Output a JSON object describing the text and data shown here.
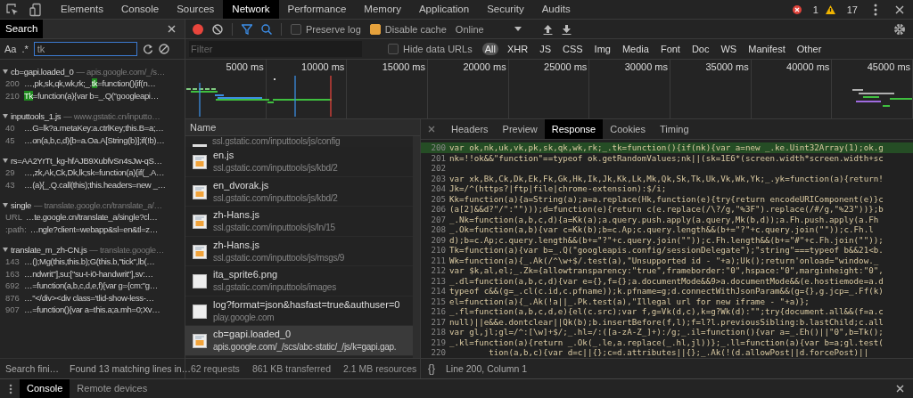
{
  "toolbar": {
    "tabs": [
      {
        "label": "Elements",
        "selected": false
      },
      {
        "label": "Console",
        "selected": false
      },
      {
        "label": "Sources",
        "selected": false
      },
      {
        "label": "Network",
        "selected": true
      },
      {
        "label": "Performance",
        "selected": false
      },
      {
        "label": "Memory",
        "selected": false
      },
      {
        "label": "Application",
        "selected": false
      },
      {
        "label": "Security",
        "selected": false
      },
      {
        "label": "Audits",
        "selected": false
      }
    ],
    "errors": "1",
    "warnings": "17"
  },
  "search_panel": {
    "tab": "Search",
    "match_case": "Aa",
    "regex": ".*",
    "query": "tk",
    "groups": [
      {
        "file": "cb=gapi.loaded_0",
        "source": "— apis.google.com/_/s…",
        "expanded": true,
        "matches": [
          {
            "line": "200",
            "before": "…,pk,sk,qk,wk,rk;_.",
            "match": "tk",
            "after": "=function(){if(n…"
          },
          {
            "line": "210",
            "match": "Tk",
            "after": "=function(a){var b=_.Q(\"googleapi…"
          }
        ]
      },
      {
        "file": "inputtools_1.js",
        "source": "— www.gstatic.cn/inputto…",
        "expanded": true,
        "matches": [
          {
            "line": "40",
            "before": "…G=lk?a.metaKey:a.ctrlKey;this.B=a;…"
          },
          {
            "line": "45",
            "before": "…on(a,b,c,d){b=a.Oa.A[String(b)];if(!b)…"
          }
        ]
      },
      {
        "file": "rs=AA2YrTt_kg-hfAJB9XubfvSn4sJw-qS…",
        "expanded": true,
        "matches": [
          {
            "line": "29",
            "before": "…,zk,Ak,Ck,Dk,lk;sk=function(a){if(_.A…"
          },
          {
            "line": "43",
            "before": "…(a){_.Q.call(this);this.headers=new _…"
          }
        ]
      },
      {
        "file": "single",
        "source": "— translate.google.cn/translate_a/…",
        "expanded": true,
        "matches": [
          {
            "line": "URL",
            "before": "…te.google.cn/translate_a/single?cl…"
          },
          {
            "line": ":path:",
            "before": "…ngle?client=webapp&sl=en&tl=z…"
          }
        ]
      },
      {
        "file": "translate_m_zh-CN.js",
        "source": "— translate.google…",
        "expanded": true,
        "matches": [
          {
            "line": "143",
            "before": "…();Mg(this,this.b);G(this.b,\"tick\",lb(…"
          },
          {
            "line": "163",
            "before": "…ndwrit\"],su:[\"su-t-i0-handwrit\"],sv:…"
          },
          {
            "line": "692",
            "before": "…=function(a,b,c,d,e,f){var g={cm:\"g…"
          },
          {
            "line": "876",
            "before": "…\"</div><div class='tlid-show-less-…"
          },
          {
            "line": "907",
            "before": "…=function(){var a=this.a;a.mh=0;Xv…"
          }
        ]
      }
    ],
    "status": "Search fini…",
    "summary": "Found 13 matching lines in…"
  },
  "network": {
    "recording": true,
    "preserve_log": {
      "label": "Preserve log",
      "checked": false
    },
    "disable_cache": {
      "label": "Disable cache",
      "checked": true
    },
    "throttling": "Online",
    "filter_placeholder": "Filter",
    "hide_data_urls": {
      "label": "Hide data URLs",
      "checked": false
    },
    "types": [
      {
        "label": "All",
        "selected": true
      },
      {
        "label": "XHR",
        "selected": false
      },
      {
        "label": "JS",
        "selected": false
      },
      {
        "label": "CSS",
        "selected": false
      },
      {
        "label": "Img",
        "selected": false
      },
      {
        "label": "Media",
        "selected": false
      },
      {
        "label": "Font",
        "selected": false
      },
      {
        "label": "Doc",
        "selected": false
      },
      {
        "label": "WS",
        "selected": false
      },
      {
        "label": "Manifest",
        "selected": false
      },
      {
        "label": "Other",
        "selected": false
      }
    ],
    "timeline_ticks": [
      "5000 ms",
      "10000 ms",
      "15000 ms",
      "20000 ms",
      "25000 ms",
      "30000 ms",
      "35000 ms",
      "40000 ms",
      "45000 ms"
    ],
    "name_header": "Name",
    "partial_row": {
      "url": "ssl.gstatic.com/inputtools/js/config"
    },
    "requests": [
      {
        "name": "en.js",
        "url": "ssl.gstatic.com/inputtools/js/kbd/2",
        "kind": "script",
        "selected": false
      },
      {
        "name": "en_dvorak.js",
        "url": "ssl.gstatic.com/inputtools/js/kbd/2",
        "kind": "script",
        "selected": false
      },
      {
        "name": "zh-Hans.js",
        "url": "ssl.gstatic.com/inputtools/js/ln/15",
        "kind": "script",
        "selected": false
      },
      {
        "name": "zh-Hans.js",
        "url": "ssl.gstatic.com/inputtools/js/msgs/9",
        "kind": "script",
        "selected": false
      },
      {
        "name": "ita_sprite6.png",
        "url": "ssl.gstatic.com/inputtools/images",
        "kind": "image",
        "selected": false
      },
      {
        "name": "log?format=json&hasfast=true&authuser=0",
        "url": "play.google.com",
        "kind": "other",
        "selected": false
      },
      {
        "name": "cb=gapi.loaded_0",
        "url": "apis.google.com/_/scs/abc-static/_/js/k=gapi.gap.",
        "kind": "script",
        "selected": true
      }
    ],
    "summary": [
      "62 requests",
      "861 KB transferred",
      "2.1 MB resources"
    ],
    "detail_tabs": [
      {
        "label": "Headers",
        "selected": false
      },
      {
        "label": "Preview",
        "selected": false
      },
      {
        "label": "Response",
        "selected": true
      },
      {
        "label": "Cookies",
        "selected": false
      },
      {
        "label": "Timing",
        "selected": false
      }
    ],
    "code_lines": [
      {
        "number": "200",
        "text": "var ok,nk,uk,vk,pk,sk,qk,wk,rk;_.tk=function(){if(nk){var a=new _.ke.Uint32Array(1);ok.g",
        "highlighted": true
      },
      {
        "number": "201",
        "text": "nk=!!ok&&\"function\"==typeof ok.getRandomValues;nk||(sk=1E6*(screen.width*screen.width+sc",
        "highlighted": false
      },
      {
        "number": "202",
        "highlighted": false
      },
      {
        "number": "203",
        "text": "var xk,Bk,Ck,Dk,Ek,Fk,Gk,Hk,Ik,Jk,Kk,Lk,Mk,Qk,Sk,Tk,Uk,Vk,Wk,Yk;_.yk=function(a){return!",
        "highlighted": false
      },
      {
        "number": "204",
        "text": "Jk=/^(https?|ftp|file|chrome-extension):$/i;",
        "highlighted": false
      },
      {
        "number": "205",
        "text": "Kk=function(a){a=String(a);a=a.replace(Hk,function(e){try{return encodeURIComponent(e)}c",
        "highlighted": false
      },
      {
        "number": "206",
        "text": "(a[2]&&d?\"/\":\"\")));d=function(e){return c(e.replace(/\\?/g,\"%3F\").replace(/#/g,\"%23\"))};b",
        "highlighted": false
      },
      {
        "number": "207",
        "text": "_.Nk=function(a,b,c,d){a=Kk(a);a.query.push.apply(a.query,Mk(b,d));a.Fh.push.apply(a.Fh",
        "highlighted": false
      },
      {
        "number": "208",
        "text": "_.Ok=function(a,b){var c=Kk(b);b=c.Ap;c.query.length&&(b+=\"?\"+c.query.join(\"\"));c.Fh.l",
        "highlighted": false
      },
      {
        "number": "209",
        "text": "d);b=c.Ap;c.query.length&&(b+=\"?\"+c.query.join(\"\"));c.Fh.length&&(b+=\"#\"+c.Fh.join(\"\"));",
        "highlighted": false
      },
      {
        "number": "210",
        "text": "Tk=function(a){var b=_.Q(\"googleapis.config/sessionDelegate\");\"string\"===typeof b&&21<b.",
        "highlighted": false
      },
      {
        "number": "211",
        "text": "Wk=function(a){_.Ak(/^\\w+$/.test(a),\"Unsupported id - \"+a);Uk();return'onload=\"window._",
        "highlighted": false
      },
      {
        "number": "212",
        "text": "var $k,al,el;_.Zk={allowtransparency:\"true\",frameborder:\"0\",hspace:\"0\",marginheight:\"0\",",
        "highlighted": false
      },
      {
        "number": "213",
        "text": "_.dl=function(a,b,c,d){var e={},f={};a.documentMode&&9>a.documentMode&&(e.hostiemode=a.d",
        "highlighted": false
      },
      {
        "number": "214",
        "text": "typeof c&&(g=_.cl(c.id,c.pfname));k.pfname=g;d.connectWithJsonParam&&(g={},g.jcp=_.Ff(k)",
        "highlighted": false
      },
      {
        "number": "215",
        "text": "el=function(a){_.Ak(!a||_.Pk.test(a),\"Illegal url for new iframe - \"+a)};",
        "highlighted": false
      },
      {
        "number": "216",
        "text": "_.fl=function(a,b,c,d,e){el(c.src);var f,g=Vk(d,c),k=g?Wk(d):\"\";try{document.all&&(f=a.c",
        "highlighted": false
      },
      {
        "number": "217",
        "text": "null)||e&&e.dontclear||Qk(b);b.insertBefore(f,l);f=l?l.previousSibling:b.lastChild;c.all",
        "highlighted": false
      },
      {
        "number": "218",
        "text": "var gl,jl;gl=/^:[\\w]+$/;_.hl=/:([a-zA-Z_]+):/g;_.il=function(){var a=_.Eh()||\"0\",b=Tk();",
        "highlighted": false
      },
      {
        "number": "219",
        "text": "_.kl=function(a){return _.Ok(_.le,a.replace(_.hl,jl))};_.ll=function(a){var b=a;gl.test(",
        "highlighted": false
      },
      {
        "number": "220",
        "text": "        tion(a,b,c){var d=c||{};c=d.attributes||{};_.Ak(!(d.allowPost||d.forcePost)||",
        "highlighted": false
      }
    ],
    "format_button": "{}",
    "cursor_position": "Line 200, Column 1"
  },
  "drawer": {
    "tabs": [
      {
        "label": "Console",
        "selected": true
      },
      {
        "label": "Remote devices",
        "selected": false
      }
    ]
  }
}
